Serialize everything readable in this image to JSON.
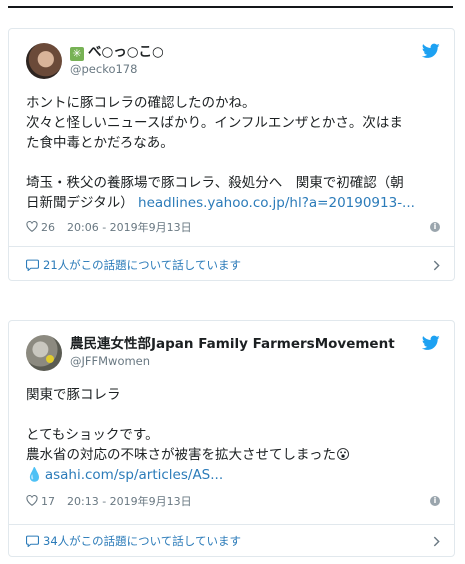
{
  "tweets": [
    {
      "author_name": "べ○っ○こ○",
      "author_prefix_icon": "sparkle-icon",
      "handle": "@pecko178",
      "lines": [
        "ホントに豚コレラの確認したのかね。",
        "次々と怪しいニュースばかり。インフルエンザとかさ。次はま",
        "た食中毒とかだろなあ。",
        "",
        "埼玉・秩父の養豚場で豚コレラ、殺処分へ　関東で初確認（朝"
      ],
      "last_line_text": "日新聞デジタル）",
      "link_text": "headlines.yahoo.co.jp/hl?a=20190913-...",
      "likes": "26",
      "time": "20:06 - 2019年9月13日",
      "conversation": "21人がこの話題について話しています"
    },
    {
      "author_name": "農民連女性部Japan Family FarmersMovement",
      "handle": "@JFFMwomen",
      "lines": [
        "関東で豚コレラ",
        "",
        "とてもショックです。"
      ],
      "line_with_emoji": "農水省の対応の不味さが被害を拡大させてしまった",
      "emoji": "😮",
      "link_text": "asahi.com/sp/articles/AS...",
      "likes": "17",
      "time": "20:13 - 2019年9月13日",
      "conversation": "34人がこの話題について話しています"
    }
  ],
  "colors": {
    "link": "#2b7bb9",
    "meta": "#697882",
    "border": "#e1e8ed",
    "twitter_blue": "#1da1f2"
  }
}
